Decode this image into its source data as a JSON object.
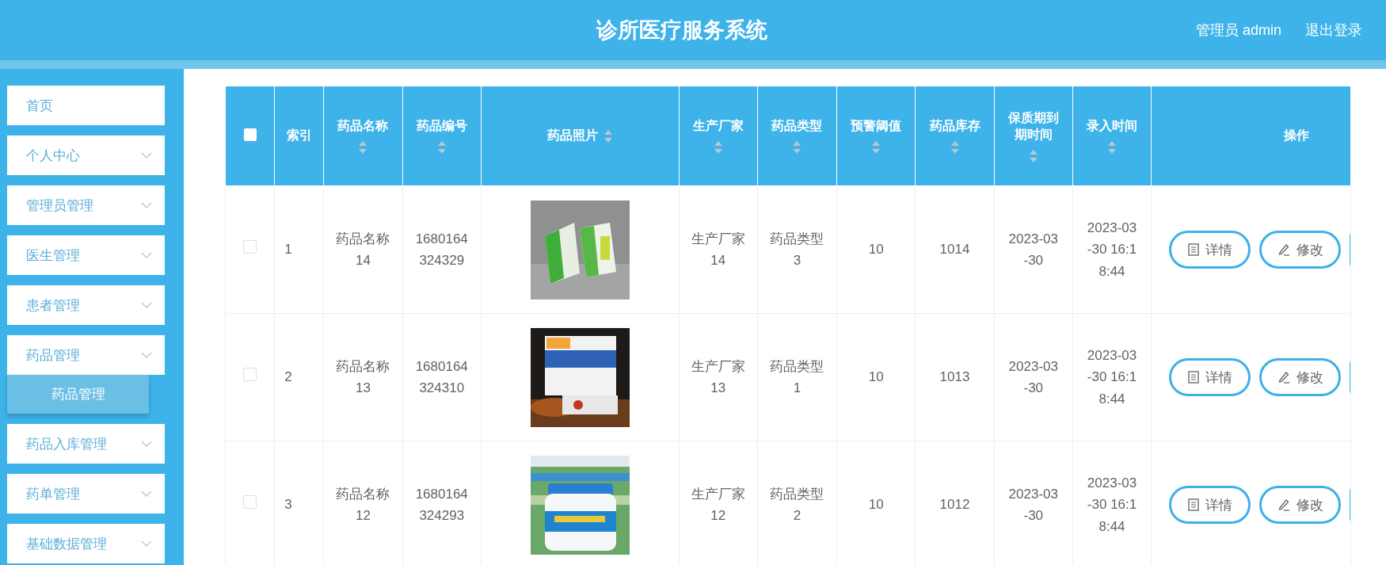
{
  "header": {
    "title": "诊所医疗服务系统",
    "user": "管理员 admin",
    "logout": "退出登录"
  },
  "sidebar": {
    "items": [
      {
        "label": "首页",
        "kind": "link"
      },
      {
        "label": "个人中心",
        "kind": "menu"
      },
      {
        "label": "管理员管理",
        "kind": "menu"
      },
      {
        "label": "医生管理",
        "kind": "menu"
      },
      {
        "label": "患者管理",
        "kind": "menu"
      },
      {
        "label": "药品管理",
        "kind": "menu",
        "children": [
          {
            "label": "药品管理",
            "selected": true
          }
        ]
      },
      {
        "label": "药品入库管理",
        "kind": "menu"
      },
      {
        "label": "药单管理",
        "kind": "menu"
      },
      {
        "label": "基础数据管理",
        "kind": "menu"
      }
    ]
  },
  "table": {
    "all_checked": false,
    "columns": [
      {
        "label": "索引",
        "sortable": false
      },
      {
        "label": "药品名称",
        "sortable": true
      },
      {
        "label": "药品编号",
        "sortable": true
      },
      {
        "label": "药品照片",
        "sortable": true
      },
      {
        "label": "生产厂家",
        "sortable": true
      },
      {
        "label": "药品类型",
        "sortable": true
      },
      {
        "label": "预警阈值",
        "sortable": true
      },
      {
        "label": "药品库存",
        "sortable": true
      },
      {
        "label": "保质期到期时间",
        "sortable": true
      },
      {
        "label": "录入时间",
        "sortable": true
      },
      {
        "label": "操作",
        "sortable": false
      }
    ],
    "rows": [
      {
        "checked": false,
        "index": "1",
        "name": "药品名称14",
        "code": "1680164324329",
        "photo": {
          "kind": "picture"
        },
        "maker": "生产厂家14",
        "type": "药品类型3",
        "threshold": "10",
        "stock": "1014",
        "expiry": "2023-03-30",
        "created": "2023-03-30 16:18:44",
        "actions": [
          "详情",
          "修改"
        ]
      },
      {
        "checked": false,
        "index": "2",
        "name": "药品名称13",
        "code": "1680164324310",
        "photo": {
          "kind": "picture"
        },
        "maker": "生产厂家13",
        "type": "药品类型1",
        "threshold": "10",
        "stock": "1013",
        "expiry": "2023-03-30",
        "created": "2023-03-30 16:18:44",
        "actions": [
          "详情",
          "修改"
        ]
      },
      {
        "checked": false,
        "index": "3",
        "name": "药品名称12",
        "code": "1680164324293",
        "photo": {
          "kind": "picture"
        },
        "maker": "生产厂家12",
        "type": "药品类型2",
        "threshold": "10",
        "stock": "1012",
        "expiry": "2023-03-30",
        "created": "2023-03-30 16:18:44",
        "actions": [
          "详情",
          "修改"
        ]
      }
    ]
  }
}
